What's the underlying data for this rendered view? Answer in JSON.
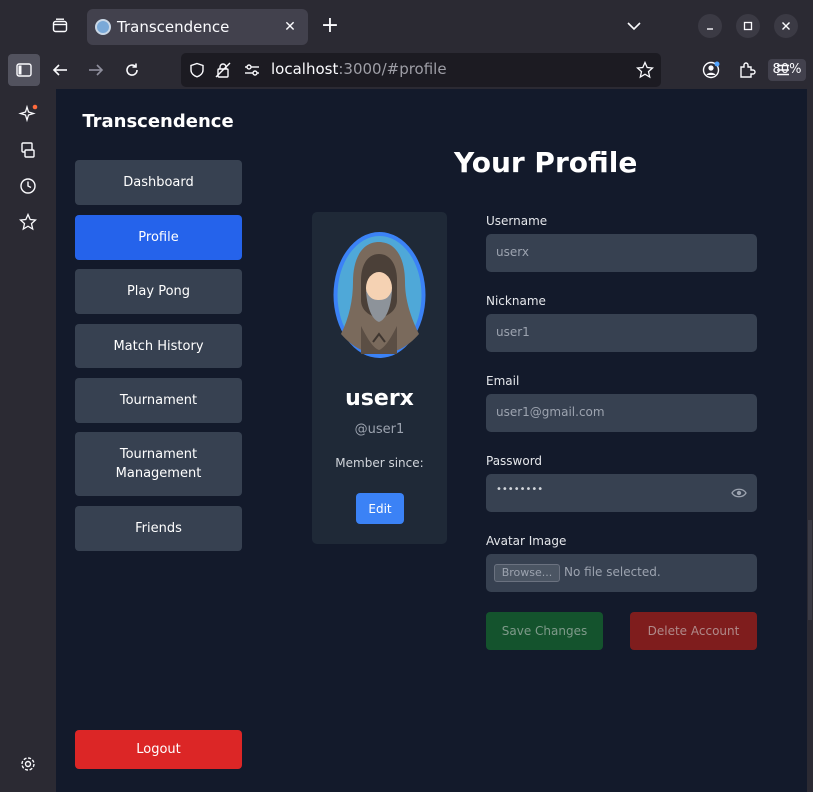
{
  "browser": {
    "tab_title": "Transcendence",
    "url_host": "localhost",
    "url_rest": ":3000/#profile",
    "zoom": "80%"
  },
  "app": {
    "brand": "Transcendence",
    "nav": [
      {
        "label": "Dashboard",
        "active": false
      },
      {
        "label": "Profile",
        "active": true
      },
      {
        "label": "Play Pong",
        "active": false
      },
      {
        "label": "Match History",
        "active": false
      },
      {
        "label": "Tournament",
        "active": false
      },
      {
        "label": "Tournament Management",
        "active": false
      },
      {
        "label": "Friends",
        "active": false
      }
    ],
    "logout_label": "Logout"
  },
  "profile": {
    "page_title": "Your Profile",
    "display_name": "userx",
    "handle": "@user1",
    "member_since_label": "Member since:",
    "edit_label": "Edit"
  },
  "form": {
    "username_label": "Username",
    "username_value": "userx",
    "nickname_label": "Nickname",
    "nickname_value": "user1",
    "email_label": "Email",
    "email_value": "user1@gmail.com",
    "password_label": "Password",
    "password_value": "••••••••",
    "avatar_label": "Avatar Image",
    "browse_label": "Browse...",
    "no_file_label": "No file selected.",
    "save_label": "Save Changes",
    "delete_label": "Delete Account"
  },
  "colors": {
    "primary": "#2563eb",
    "danger": "#dc2626",
    "page_bg": "#131a2b",
    "card_bg": "#1f2937"
  }
}
